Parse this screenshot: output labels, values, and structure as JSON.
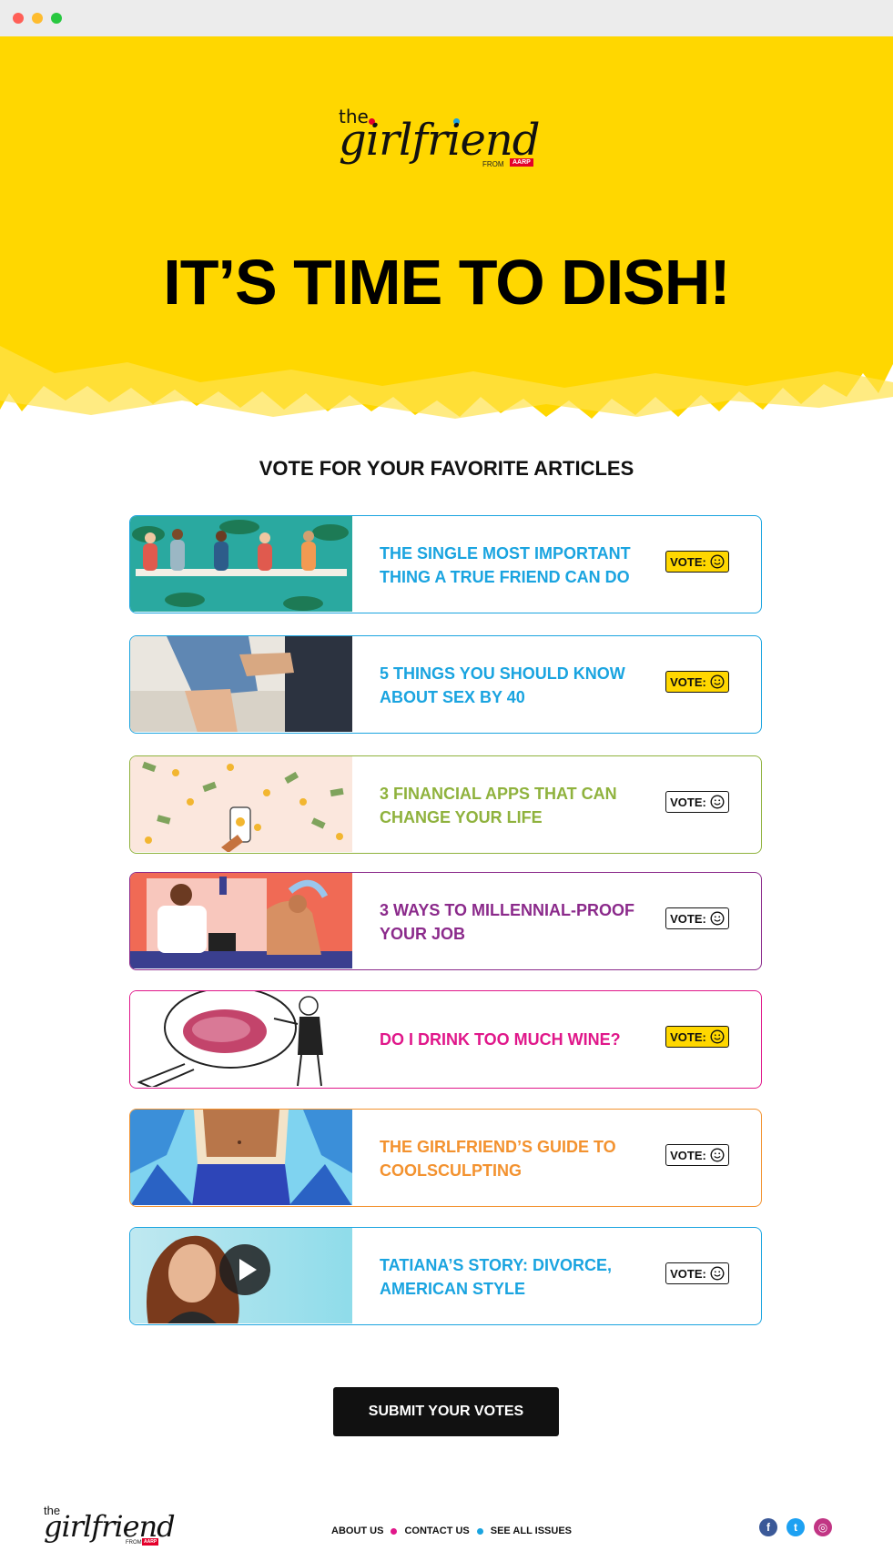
{
  "brand": {
    "the": "the",
    "name": "girlfriend",
    "from": "FROM",
    "aarp": "AARP"
  },
  "hero": {
    "headline": "IT’S TIME TO DISH!",
    "color": "#ffd700"
  },
  "section_title": "VOTE FOR YOUR FAVORITE ARTICLES",
  "vote_label": "VOTE:",
  "articles": [
    {
      "title": "THE SINGLE MOST IMPORTANT THING A TRUE FRIEND CAN DO",
      "color": "#1aa4e0",
      "voted": true
    },
    {
      "title": "5 THINGS YOU SHOULD KNOW ABOUT SEX BY 40",
      "color": "#1aa4e0",
      "voted": true
    },
    {
      "title": "3 FINANCIAL APPS THAT CAN CHANGE YOUR LIFE",
      "color": "#8fb23d",
      "voted": false
    },
    {
      "title": "3 WAYS TO MILLENNIAL-PROOF YOUR JOB",
      "color": "#8b2a8b",
      "voted": false
    },
    {
      "title": "DO I DRINK TOO MUCH WINE?",
      "color": "#e0178a",
      "voted": true
    },
    {
      "title": "THE GIRLFRIEND’S GUIDE TO COOLSCULPTING",
      "color": "#f3922f",
      "voted": false
    },
    {
      "title": "TATIANA’S STORY: DIVORCE, AMERICAN STYLE",
      "color": "#1aa4e0",
      "voted": false
    }
  ],
  "submit_label": "SUBMIT YOUR VOTES",
  "footer": {
    "nav": [
      "ABOUT US",
      "CONTACT US",
      "SEE ALL ISSUES"
    ],
    "nav_dot_colors": [
      "#e0178a",
      "#1aa4e0"
    ],
    "social_icons": [
      "facebook-icon",
      "twitter-icon",
      "instagram-icon"
    ]
  }
}
